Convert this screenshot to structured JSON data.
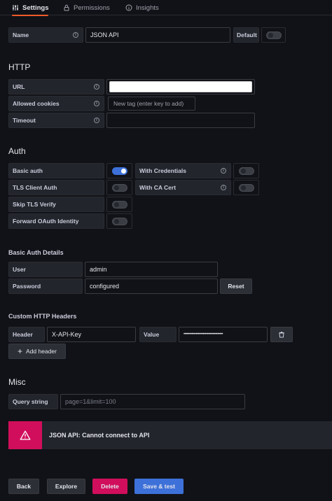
{
  "tabs": [
    {
      "label": "Settings",
      "icon": "sliders-icon"
    },
    {
      "label": "Permissions",
      "icon": "lock-icon"
    },
    {
      "label": "Insights",
      "icon": "info-icon"
    }
  ],
  "name_row": {
    "label": "Name",
    "value": "JSON API",
    "default_label": "Default",
    "default_on": false
  },
  "http": {
    "title": "HTTP",
    "url_label": "URL",
    "url_value": "",
    "cookies_label": "Allowed cookies",
    "cookies_placeholder": "New tag (enter key to add)",
    "timeout_label": "Timeout",
    "timeout_value": ""
  },
  "auth": {
    "title": "Auth",
    "basic_auth": "Basic auth",
    "with_credentials": "With Credentials",
    "tls_client_auth": "TLS Client Auth",
    "with_ca_cert": "With CA Cert",
    "skip_tls_verify": "Skip TLS Verify",
    "forward_oauth": "Forward OAuth Identity",
    "basic_auth_on": true
  },
  "basic_auth_details": {
    "title": "Basic Auth Details",
    "user_label": "User",
    "user_value": "admin",
    "password_label": "Password",
    "password_value": "configured",
    "reset_label": "Reset"
  },
  "custom_headers": {
    "title": "Custom HTTP Headers",
    "header_label": "Header",
    "header_value": "X-API-Key",
    "value_label": "Value",
    "value_masked": "•••••••••••••••••••••••••••••••••••",
    "add_label": "Add header"
  },
  "misc": {
    "title": "Misc",
    "query_label": "Query string",
    "query_placeholder": "page=1&limit=100"
  },
  "alert": {
    "text": "JSON API: Cannot connect to API"
  },
  "footer": {
    "back": "Back",
    "explore": "Explore",
    "delete": "Delete",
    "save_test": "Save & test"
  },
  "colors": {
    "accent": "#3d71d9",
    "danger": "#d10e5c",
    "tab_underline": "#f05a28",
    "background": "#111217"
  }
}
